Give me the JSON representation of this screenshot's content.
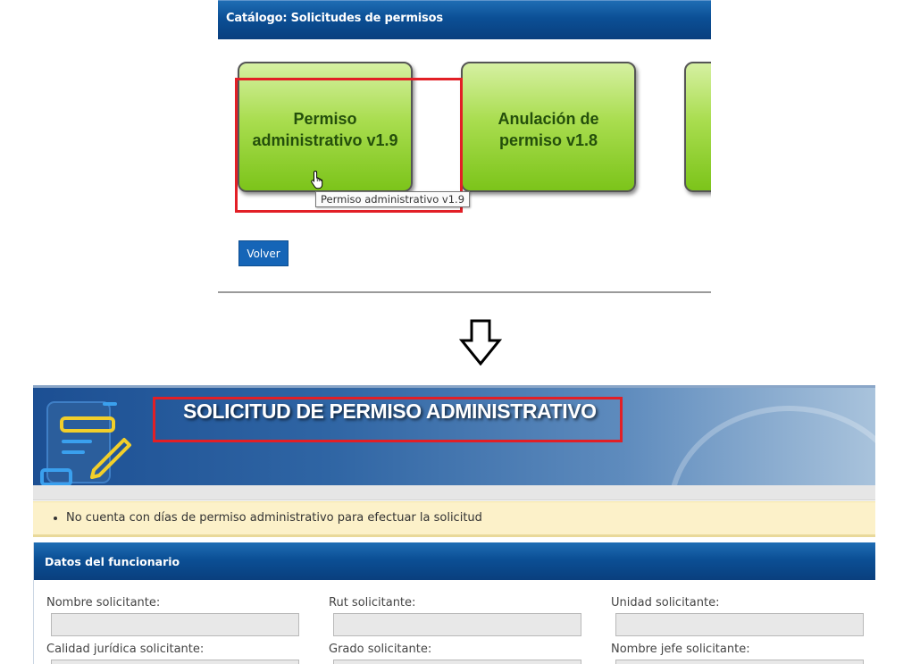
{
  "catalog": {
    "title": "Catálogo: Solicitudes de permisos",
    "tiles": [
      {
        "label_line1": "Permiso",
        "label_line2": "administrativo v1.9"
      },
      {
        "label_line1": "Anulación de",
        "label_line2": "permiso v1.8"
      },
      {
        "label_line1": "",
        "label_line2": ""
      }
    ],
    "tooltip": "Permiso administrativo v1.9",
    "back_label": "Volver"
  },
  "form": {
    "title": "SOLICITUD DE PERMISO ADMINISTRATIVO",
    "warning": "No cuenta con días de permiso administrativo para efectuar la solicitud",
    "section_title": "Datos del funcionario",
    "fields": [
      {
        "label": "Nombre solicitante:",
        "value": ""
      },
      {
        "label": "Rut solicitante:",
        "value": ""
      },
      {
        "label": "Unidad solicitante:",
        "value": ""
      },
      {
        "label": "Calidad jurídica solicitante:",
        "value": ""
      },
      {
        "label": "Grado solicitante:",
        "value": ""
      },
      {
        "label": "Nombre jefe solicitante:",
        "value": ""
      }
    ]
  },
  "colors": {
    "header_blue": "#0b4f95",
    "tile_green": "#7cc41a",
    "highlight_red": "#e21f26",
    "button_blue": "#1565b7",
    "warning_bg": "#fcf1c9"
  },
  "icons": [
    "hand-pointer-icon",
    "down-arrow-icon",
    "form-pencil-icon"
  ]
}
